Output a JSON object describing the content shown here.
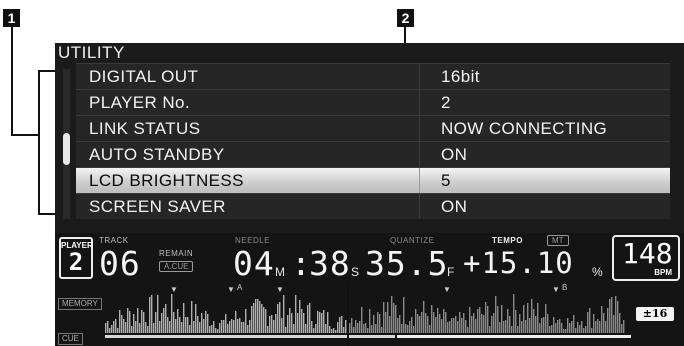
{
  "callouts": {
    "one": "1",
    "two": "2"
  },
  "utility": {
    "title": "UTILITY",
    "items": [
      {
        "label": "DIGITAL OUT",
        "value": "16bit"
      },
      {
        "label": "PLAYER No.",
        "value": "2"
      },
      {
        "label": "LINK STATUS",
        "value": "NOW CONNECTING"
      },
      {
        "label": "AUTO STANDBY",
        "value": "ON"
      },
      {
        "label": "LCD BRIGHTNESS",
        "value": "5",
        "selected": true
      },
      {
        "label": "SCREEN SAVER",
        "value": "ON"
      }
    ]
  },
  "status": {
    "player_label": "PLAYER",
    "player_number": "2",
    "track_label": "TRACK",
    "track_number": "06",
    "remain_label": "REMAIN",
    "acue_label": "A.CUE",
    "needle_label": "NEEDLE",
    "minutes": "04",
    "minutes_unit": "M",
    "colon": ":",
    "seconds": "38",
    "seconds_unit": "S",
    "frames": "35.5",
    "frames_unit": "F",
    "quantize_label": "QUANTIZE",
    "tempo_label": "TEMPO",
    "mt_label": "MT",
    "tempo_value": "+15.10",
    "tempo_unit": "%",
    "bpm_value": "148",
    "bpm_label": "BPM",
    "tempo_range": "±16",
    "memory_label": "MEMORY",
    "cue_label": "CUE",
    "marker_a": "A",
    "marker_b": "B"
  },
  "colors": {
    "lcd_bg": "#1b1b1b",
    "text": "#f2f2f2",
    "highlight": "#e0e0e0"
  }
}
